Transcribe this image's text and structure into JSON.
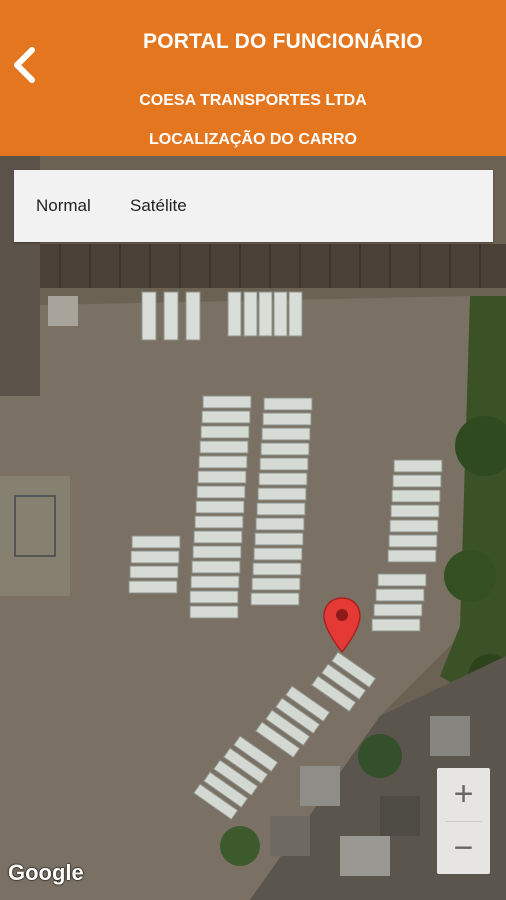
{
  "header": {
    "title": "PORTAL DO FUNCIONÁRIO",
    "company": "COESA TRANSPORTES LTDA",
    "subtitle": "LOCALIZAÇÃO DO CARRO",
    "back_icon": "chevron-left-icon",
    "color": "#e4761f"
  },
  "map": {
    "type_options": [
      "Normal",
      "Satélite"
    ],
    "zoom_in_label": "+",
    "zoom_out_label": "−",
    "attribution": "Google",
    "marker_color": "#e53935"
  }
}
